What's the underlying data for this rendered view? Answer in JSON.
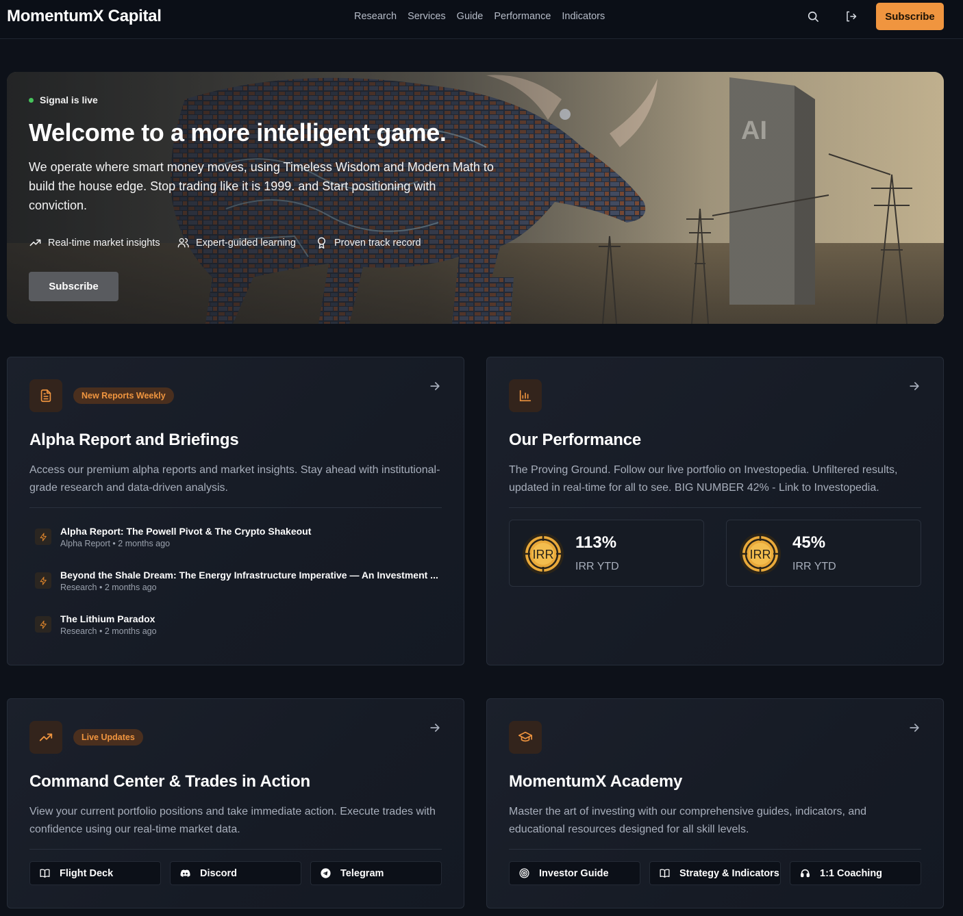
{
  "header": {
    "brand": "MomentumX Capital",
    "nav": [
      "Research",
      "Services",
      "Guide",
      "Performance",
      "Indicators"
    ],
    "subscribe_label": "Subscribe"
  },
  "hero": {
    "status": "Signal is live",
    "title": "Welcome to a more intelligent game.",
    "lead": "We operate where smart money moves, using Timeless Wisdom and Modern Math to build the house edge. Stop trading like it is 1999. and Start positioning with conviction.",
    "features": [
      "Real-time market insights",
      "Expert-guided learning",
      "Proven track record"
    ],
    "cta_label": "Subscribe",
    "image_text": "AI"
  },
  "alpha": {
    "badge": "New Reports Weekly",
    "title": "Alpha Report and Briefings",
    "desc": "Access our premium alpha reports and market insights. Stay ahead with institutional-grade research and data-driven analysis.",
    "reports": [
      {
        "title": "Alpha Report: The Powell Pivot & The Crypto Shakeout",
        "meta": "Alpha Report • 2 months ago"
      },
      {
        "title": "Beyond the Shale Dream: The Energy Infrastructure Imperative — An Investment ...",
        "meta": "Research • 2 months ago"
      },
      {
        "title": "The Lithium Paradox",
        "meta": "Research • 2 months ago"
      }
    ]
  },
  "performance": {
    "title": "Our Performance",
    "desc": "The Proving Ground. Follow our live portfolio on Investopedia. Unfiltered results, updated in real-time for all to see. BIG NUMBER 42% - Link to Investopedia.",
    "coin_label": "IRR",
    "stats": [
      {
        "value": "113%",
        "label": "IRR YTD"
      },
      {
        "value": "45%",
        "label": "IRR YTD"
      }
    ]
  },
  "command": {
    "badge": "Live Updates",
    "title": "Command Center & Trades in Action",
    "desc": "View your current portfolio positions and take immediate action. Execute trades with confidence using our real-time market data.",
    "links": [
      "Flight Deck",
      "Discord",
      "Telegram"
    ]
  },
  "academy": {
    "title": "MomentumX Academy",
    "desc": "Master the art of investing with our comprehensive guides, indicators, and educational resources designed for all skill levels.",
    "links": [
      "Investor Guide",
      "Strategy & Indicators",
      "1:1 Coaching"
    ]
  },
  "colors": {
    "accent": "#f0953f",
    "background": "#0d1119",
    "card": "#1b202b",
    "live": "#46c35b"
  },
  "icons": [
    "search-icon",
    "logout-icon",
    "trend-up-icon",
    "users-icon",
    "award-icon",
    "document-icon",
    "arrow-right-icon",
    "bolt-icon",
    "bar-chart-icon",
    "graduation-cap-icon",
    "book-icon",
    "discord-icon",
    "telegram-icon",
    "target-icon",
    "headset-icon"
  ]
}
